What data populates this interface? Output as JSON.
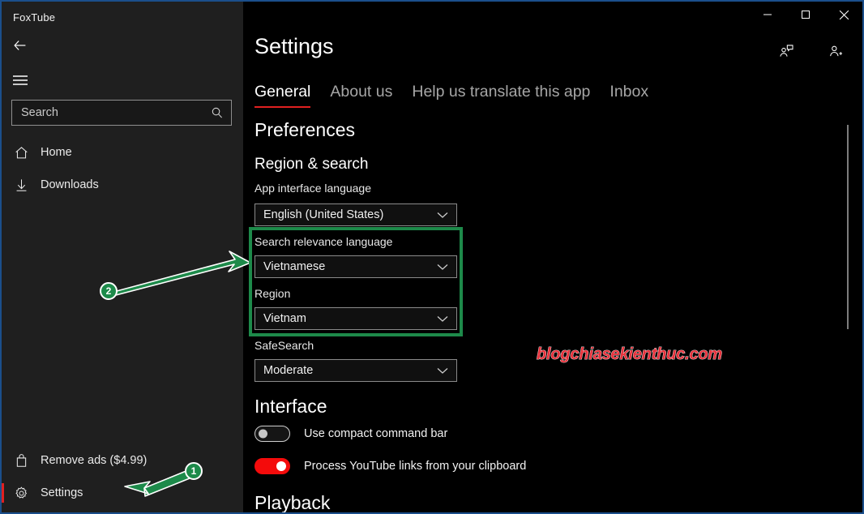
{
  "window": {
    "app_title": "FoxTube",
    "controls": {
      "minimize": "─",
      "maximize": "□",
      "close": "✕"
    }
  },
  "sidebar": {
    "back_icon": "back-arrow-icon",
    "menu_icon": "hamburger-menu-icon",
    "search": {
      "placeholder": "Search",
      "value": "",
      "icon": "search-icon"
    },
    "items": [
      {
        "label": "Home",
        "icon": "home-icon",
        "selected": false
      },
      {
        "label": "Downloads",
        "icon": "download-icon",
        "selected": false
      },
      {
        "label": "Remove ads ($4.99)",
        "icon": "shopping-bag-icon",
        "selected": false
      },
      {
        "label": "Settings",
        "icon": "gear-icon",
        "selected": true
      }
    ]
  },
  "header": {
    "title": "Settings",
    "feedback_icon": "person-feedback-icon",
    "account_icon": "person-add-icon"
  },
  "tabs": [
    {
      "label": "General",
      "active": true
    },
    {
      "label": "About us",
      "active": false
    },
    {
      "label": "Help us translate this app",
      "active": false
    },
    {
      "label": "Inbox",
      "active": false
    }
  ],
  "main": {
    "preferences_heading": "Preferences",
    "region_search_heading": "Region & search",
    "fields": [
      {
        "label": "App interface language",
        "value": "English (United States)"
      },
      {
        "label": "Search relevance language",
        "value": "Vietnamese"
      },
      {
        "label": "Region",
        "value": "Vietnam"
      },
      {
        "label": "SafeSearch",
        "value": "Moderate"
      }
    ],
    "interface_heading": "Interface",
    "toggles": [
      {
        "label": "Use compact command bar",
        "on": false
      },
      {
        "label": "Process YouTube links from your clipboard",
        "on": true
      }
    ],
    "playback_heading": "Playback"
  },
  "watermark": {
    "text": "blogchiasekienthuc.com"
  },
  "annotations": {
    "highlight_color": "#1d8a4a",
    "markers": [
      {
        "number": "1",
        "points_to": "Settings sidebar item"
      },
      {
        "number": "2",
        "points_to": "Search relevance language dropdown"
      }
    ]
  },
  "colors": {
    "accent_red": "#e02020",
    "sidebar_bg": "#1f1f1f",
    "content_bg": "#000000",
    "window_border": "#1b4f8c",
    "toggle_on": "#f40b0b",
    "annotation_green": "#1d8a4a",
    "watermark_red": "#e8323c"
  }
}
